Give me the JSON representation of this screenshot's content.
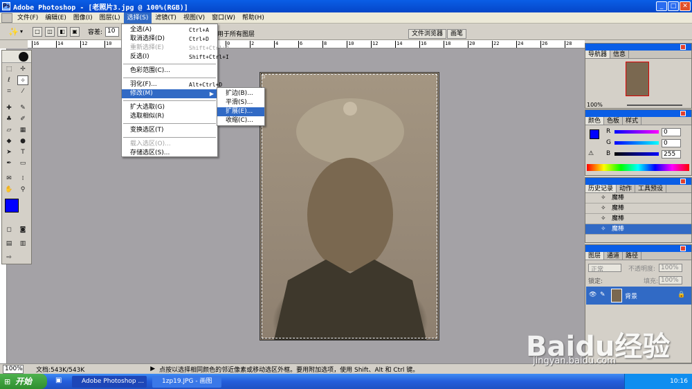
{
  "window": {
    "title": "Adobe Photoshop - [老照片3.jpg @ 100%(RGB)]"
  },
  "menubar": [
    "文件(F)",
    "编辑(E)",
    "图像(I)",
    "图层(L)",
    "选择(S)",
    "滤镜(T)",
    "视图(V)",
    "窗口(W)",
    "帮助(H)"
  ],
  "options": {
    "tolerance_label": "容差:",
    "tolerance_value": "10",
    "all_layers_label": "用于所有图层",
    "palette_tabs": [
      "文件浏览器",
      "画笔"
    ]
  },
  "ruler_ticks": [
    "16",
    "14",
    "12",
    "10",
    "8",
    "6",
    "4",
    "2",
    "0",
    "2",
    "4",
    "6",
    "8",
    "10",
    "12",
    "14",
    "16",
    "18",
    "20",
    "22",
    "24",
    "26",
    "28"
  ],
  "select_menu": [
    {
      "label": "全选(A)",
      "shortcut": "Ctrl+A"
    },
    {
      "label": "取消选择(D)",
      "shortcut": "Ctrl+D"
    },
    {
      "label": "重新选择(E)",
      "shortcut": "Shift+Ctrl+D",
      "disabled": true
    },
    {
      "label": "反选(I)",
      "shortcut": "Shift+Ctrl+I"
    },
    {
      "sep": true
    },
    {
      "label": "色彩范围(C)..."
    },
    {
      "sep": true
    },
    {
      "label": "羽化(F)...",
      "shortcut": "Alt+Ctrl+D"
    },
    {
      "label": "修改(M)",
      "submenu": true,
      "highlight": true
    },
    {
      "sep": true
    },
    {
      "label": "扩大选取(G)"
    },
    {
      "label": "选取相似(R)"
    },
    {
      "sep": true
    },
    {
      "label": "变换选区(T)"
    },
    {
      "sep": true
    },
    {
      "label": "载入选区(O)...",
      "disabled": true
    },
    {
      "label": "存储选区(S)..."
    }
  ],
  "modify_menu": [
    {
      "label": "扩边(B)..."
    },
    {
      "label": "平滑(S)..."
    },
    {
      "label": "扩展(E)...",
      "highlight": true
    },
    {
      "label": "收缩(C)..."
    }
  ],
  "navigator": {
    "tabs": [
      "导航器",
      "信息"
    ],
    "zoom": "100%"
  },
  "color": {
    "tabs": [
      "颜色",
      "色板",
      "样式"
    ],
    "r_label": "R",
    "g_label": "G",
    "b_label": "B",
    "r": "0",
    "g": "0",
    "b": "255"
  },
  "history": {
    "tabs": [
      "历史记录",
      "动作",
      "工具预设"
    ],
    "items": [
      "魔棒",
      "魔棒",
      "魔棒",
      "魔棒"
    ]
  },
  "layers": {
    "tabs": [
      "图层",
      "通道",
      "路径"
    ],
    "mode": "正常",
    "opacity_label": "不透明度:",
    "opacity": "100%",
    "lock_label": "锁定:",
    "fill_label": "填充:",
    "fill": "100%",
    "layer_name": "背景"
  },
  "statusbar": {
    "zoom": "100%",
    "doc": "文档:543K/543K",
    "hint": "点按以选择相同颜色的邻近像素或移动选区外框。要用附加选项，使用 Shift、Alt 和 Ctrl 键。"
  },
  "taskbar": {
    "start": "开始",
    "tasks": [
      "Adobe Photoshop ...",
      "1zp19.JPG - 画图"
    ],
    "time": "10:16"
  },
  "watermark": {
    "text": "Baidu经验",
    "url": "jingyan.baidu.com"
  },
  "colors": {
    "foreground": "#0000ff",
    "background": "#ffffff",
    "accent": "#316ac5"
  }
}
